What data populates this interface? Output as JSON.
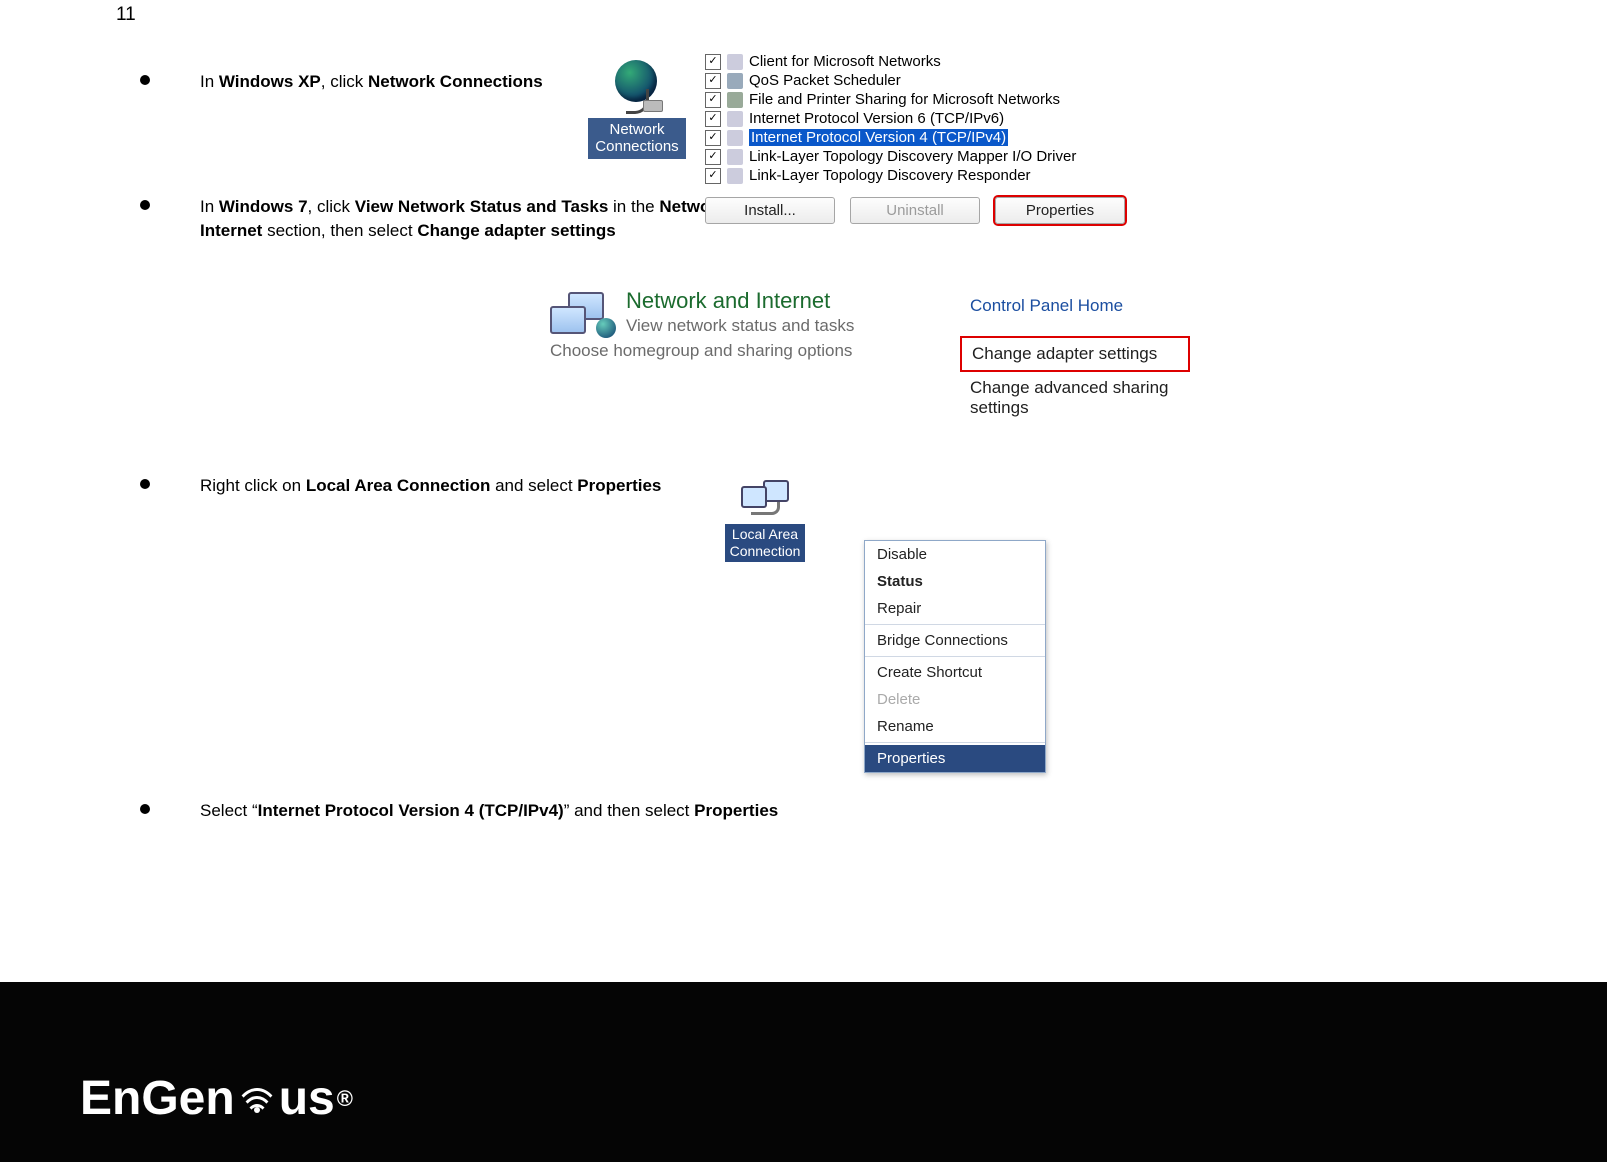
{
  "page_number": "11",
  "bullets": {
    "xp": {
      "pre": "In ",
      "b1": "Windows XP",
      "mid": ", click ",
      "b2": "Network Connections"
    },
    "w7": {
      "pre": "In ",
      "b1": "Windows 7",
      "mid1": ", click ",
      "b2": "View Network Status and Tasks",
      "mid2": " in the ",
      "b3": "Network and Internet",
      "mid3": " section, then select ",
      "b4": "Change adapter settings"
    },
    "lac": {
      "pre": "Right click on ",
      "b1": "Local Area Connection",
      "mid": " and select ",
      "b2": "Properties"
    },
    "ipv4": {
      "pre": "Select “",
      "b1": "Internet Protocol Version 4 (TCP/IPv4)",
      "mid": "” and then  select ",
      "b2": "Properties"
    }
  },
  "nc_label_line1": "Network",
  "nc_label_line2": "Connections",
  "items": [
    {
      "checked": true,
      "label": "Client for Microsoft Networks",
      "icon": "net"
    },
    {
      "checked": true,
      "label": "QoS Packet Scheduler",
      "icon": "qos"
    },
    {
      "checked": true,
      "label": "File and Printer Sharing for Microsoft Networks",
      "icon": "printer"
    },
    {
      "checked": true,
      "label": "Internet Protocol Version 6 (TCP/IPv6)",
      "icon": "net"
    },
    {
      "checked": true,
      "label": "Internet Protocol Version 4 (TCP/IPv4)",
      "icon": "net",
      "highlight": true
    },
    {
      "checked": true,
      "label": "Link-Layer Topology Discovery Mapper I/O Driver",
      "icon": "net"
    },
    {
      "checked": true,
      "label": "Link-Layer Topology Discovery Responder",
      "icon": "net"
    }
  ],
  "buttons": {
    "install": "Install...",
    "uninstall": "Uninstall",
    "properties": "Properties"
  },
  "ni": {
    "title": "Network and Internet",
    "l1": "View network status and tasks",
    "l2": "Choose homegroup and sharing options"
  },
  "sidebar": {
    "home": "Control Panel Home",
    "adapter": "Change adapter settings",
    "adv": "Change advanced sharing settings"
  },
  "lac_label_l1": "Local Area",
  "lac_label_l2": "Connection",
  "context_menu": {
    "disable": "Disable",
    "status": "Status",
    "repair": "Repair",
    "bridge": "Bridge Connections",
    "shortcut": "Create Shortcut",
    "delete": "Delete",
    "rename": "Rename",
    "properties": "Properties"
  },
  "logo_parts": {
    "p1": "EnGen",
    "p2": "us",
    "reg": "®"
  }
}
